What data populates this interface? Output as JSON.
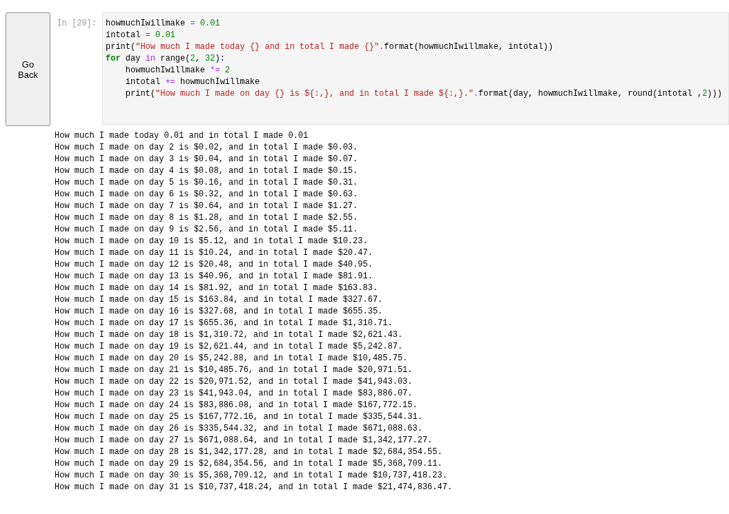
{
  "button": {
    "label": "Go Back"
  },
  "cell": {
    "prompt": "In [29]:",
    "code": [
      [
        {
          "kind": "name",
          "text": "howmuchIwillmake "
        },
        {
          "kind": "op",
          "text": "= "
        },
        {
          "kind": "num",
          "text": "0.01"
        }
      ],
      [
        {
          "kind": "name",
          "text": "intotal "
        },
        {
          "kind": "op",
          "text": "= "
        },
        {
          "kind": "num",
          "text": "0.01"
        }
      ],
      [
        {
          "kind": "name",
          "text": "print("
        },
        {
          "kind": "str",
          "text": "\"How much I made today {} and in total I made {}\""
        },
        {
          "kind": "op",
          "text": "."
        },
        {
          "kind": "name",
          "text": "format(howmuchIwillmake, intotal))"
        }
      ],
      [
        {
          "kind": "kw",
          "text": "for"
        },
        {
          "kind": "name",
          "text": " day "
        },
        {
          "kind": "op",
          "text": "in"
        },
        {
          "kind": "name",
          "text": " range("
        },
        {
          "kind": "num",
          "text": "2"
        },
        {
          "kind": "name",
          "text": ", "
        },
        {
          "kind": "num",
          "text": "32"
        },
        {
          "kind": "name",
          "text": "):"
        }
      ],
      [
        {
          "kind": "name",
          "text": "    howmuchIwillmake "
        },
        {
          "kind": "op",
          "text": "*= "
        },
        {
          "kind": "num",
          "text": "2"
        }
      ],
      [
        {
          "kind": "name",
          "text": "    intotal "
        },
        {
          "kind": "op",
          "text": "+="
        },
        {
          "kind": "name",
          "text": " howmuchIwillmake"
        }
      ],
      [
        {
          "kind": "name",
          "text": "    print("
        },
        {
          "kind": "str",
          "text": "\"How much I made on day {} is ${:,}, and in total I made ${:,}.\""
        },
        {
          "kind": "op",
          "text": "."
        },
        {
          "kind": "name",
          "text": "format(day, howmuchIwillmake, round(intotal ,"
        },
        {
          "kind": "num",
          "text": "2"
        },
        {
          "kind": "name",
          "text": ")))"
        }
      ]
    ],
    "output": [
      "How much I made today 0.01 and in total I made 0.01",
      "How much I made on day 2 is $0.02, and in total I made $0.03.",
      "How much I made on day 3 is $0.04, and in total I made $0.07.",
      "How much I made on day 4 is $0.08, and in total I made $0.15.",
      "How much I made on day 5 is $0.16, and in total I made $0.31.",
      "How much I made on day 6 is $0.32, and in total I made $0.63.",
      "How much I made on day 7 is $0.64, and in total I made $1.27.",
      "How much I made on day 8 is $1.28, and in total I made $2.55.",
      "How much I made on day 9 is $2.56, and in total I made $5.11.",
      "How much I made on day 10 is $5.12, and in total I made $10.23.",
      "How much I made on day 11 is $10.24, and in total I made $20.47.",
      "How much I made on day 12 is $20.48, and in total I made $40.95.",
      "How much I made on day 13 is $40.96, and in total I made $81.91.",
      "How much I made on day 14 is $81.92, and in total I made $163.83.",
      "How much I made on day 15 is $163.84, and in total I made $327.67.",
      "How much I made on day 16 is $327.68, and in total I made $655.35.",
      "How much I made on day 17 is $655.36, and in total I made $1,310.71.",
      "How much I made on day 18 is $1,310.72, and in total I made $2,621.43.",
      "How much I made on day 19 is $2,621.44, and in total I made $5,242.87.",
      "How much I made on day 20 is $5,242.88, and in total I made $10,485.75.",
      "How much I made on day 21 is $10,485.76, and in total I made $20,971.51.",
      "How much I made on day 22 is $20,971.52, and in total I made $41,943.03.",
      "How much I made on day 23 is $41,943.04, and in total I made $83,886.07.",
      "How much I made on day 24 is $83,886.08, and in total I made $167,772.15.",
      "How much I made on day 25 is $167,772.16, and in total I made $335,544.31.",
      "How much I made on day 26 is $335,544.32, and in total I made $671,088.63.",
      "How much I made on day 27 is $671,088.64, and in total I made $1,342,177.27.",
      "How much I made on day 28 is $1,342,177.28, and in total I made $2,684,354.55.",
      "How much I made on day 29 is $2,684,354.56, and in total I made $5,368,709.11.",
      "How much I made on day 30 is $5,368,709.12, and in total I made $10,737,418.23.",
      "How much I made on day 31 is $10,737,418.24, and in total I made $21,474,836.47."
    ]
  }
}
